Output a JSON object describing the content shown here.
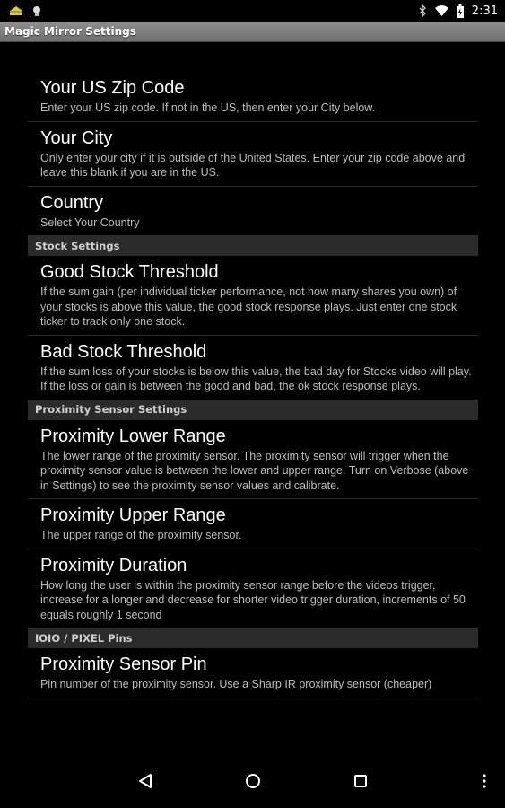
{
  "status_bar": {
    "time": "2:31",
    "left_icons": [
      "sandwich-icon",
      "lightbulb-icon"
    ],
    "right_icons": [
      "bluetooth-icon",
      "wifi-icon",
      "battery-icon"
    ]
  },
  "app": {
    "title": "Magic Mirror Settings"
  },
  "preferences": [
    {
      "title": "Your US Zip Code",
      "summary": "Enter your US zip code. If not in the US, then enter your City below."
    },
    {
      "title": "Your City",
      "summary": "Only enter your city if it is outside of the United States. Enter your zip code above and leave this blank if you are in the US."
    },
    {
      "title": "Country",
      "summary": "Select Your Country"
    }
  ],
  "stock_section": {
    "header": "Stock Settings",
    "items": [
      {
        "title": "Good Stock Threshold",
        "summary": "If the sum gain (per individual ticker performance, not how many shares you own) of your stocks is above this value, the good stock response plays. Just enter one stock ticker to track only one stock."
      },
      {
        "title": "Bad Stock Threshold",
        "summary": "If the sum loss of your stocks is below this value, the bad day for Stocks video will play. If the loss or gain is between the good and bad, the ok stock response plays."
      }
    ]
  },
  "proximity_section": {
    "header": "Proximity Sensor Settings",
    "items": [
      {
        "title": "Proximity Lower Range",
        "summary": "The lower range of the proximity sensor. The proximity sensor will trigger when the proximity sensor value is between the lower and upper range. Turn on Verbose (above in Settings) to see the proximity sensor values and calibrate."
      },
      {
        "title": "Proximity Upper Range",
        "summary": "The upper range of the proximity sensor."
      },
      {
        "title": "Proximity Duration",
        "summary": "How long the user is within the proximity sensor range before the videos trigger, increase for a longer and decrease for shorter video trigger duration, increments of 50 equals roughly 1 second"
      }
    ]
  },
  "pins_section": {
    "header": "IOIO / PIXEL Pins",
    "items": [
      {
        "title": "Proximity Sensor Pin",
        "summary": "Pin number of the proximity sensor. Use a Sharp IR proximity sensor (cheaper)"
      }
    ]
  },
  "nav_bar": {
    "buttons": [
      "back-icon",
      "home-icon",
      "recents-icon",
      "overflow-menu-icon"
    ]
  }
}
